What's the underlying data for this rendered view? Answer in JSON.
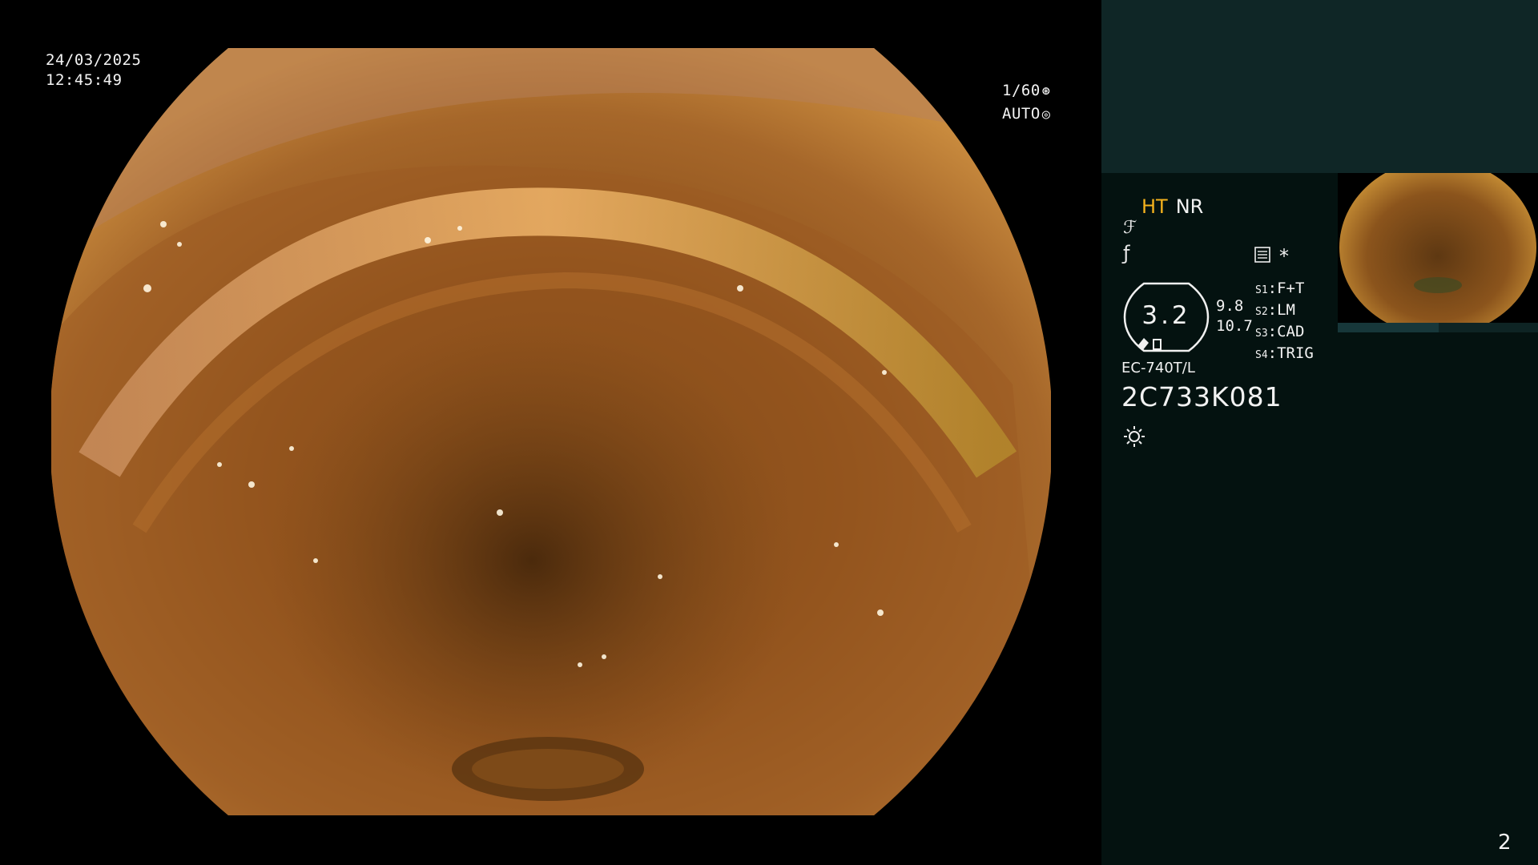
{
  "overlay": {
    "date": "24/03/2025",
    "time": "12:45:49",
    "shutter": "1/60",
    "iris": "AUTO"
  },
  "panel": {
    "ht_label": "HT",
    "nr_label": "NR",
    "gauge_value": "3.2",
    "value_top": "9.8",
    "value_bottom": "10.7",
    "switches": [
      {
        "key": "S1",
        "value": "F+T"
      },
      {
        "key": "S2",
        "value": "LM"
      },
      {
        "key": "S3",
        "value": "CAD"
      },
      {
        "key": "S4",
        "value": "TRIG"
      }
    ],
    "star": "*",
    "scope_model": "EC-740T/L",
    "serial": "2C733K081",
    "page_number": "2"
  },
  "colors": {
    "ht_accent": "#f5b21d",
    "panel_bg": "#041210",
    "panel_header": "#0f2626"
  },
  "icons": [
    "shutter-icon",
    "iris-icon",
    "enhance-icon",
    "curve-icon",
    "settings-icon",
    "light-icon"
  ]
}
